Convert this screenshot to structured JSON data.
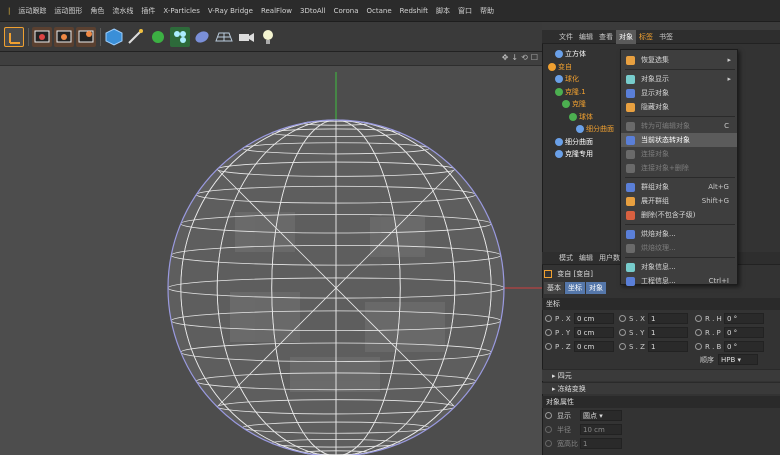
{
  "menubar": {
    "items": [
      "运动跟踪",
      "运动图形",
      "角色",
      "流水线",
      "插件",
      "X-Particles",
      "V-Ray Bridge",
      "RealFlow",
      "3DtoAll",
      "Corona",
      "Octane",
      "Redshift",
      "脚本",
      "窗口",
      "帮助"
    ]
  },
  "object_manager": {
    "tabs": [
      "文件",
      "编辑",
      "查看",
      "对象",
      "标签",
      "书签"
    ],
    "active_tab": "对象",
    "tree": [
      {
        "label": "立方体",
        "indent": 1,
        "color": "#ffffff"
      },
      {
        "label": "变自",
        "indent": 0,
        "color": "#f0a030"
      },
      {
        "label": "球化",
        "indent": 1,
        "color": "#f0a030"
      },
      {
        "label": "克隆.1",
        "indent": 1,
        "color": "#f0a030"
      },
      {
        "label": "克隆",
        "indent": 2,
        "color": "#f0a030"
      },
      {
        "label": "球体",
        "indent": 3,
        "color": "#f0a030"
      },
      {
        "label": "细分曲面",
        "indent": 4,
        "color": "#f0a030"
      },
      {
        "label": "细分曲面",
        "indent": 1,
        "color": "#ffffff"
      },
      {
        "label": "克隆专用",
        "indent": 1,
        "color": "#ffffff"
      }
    ]
  },
  "context_menu": {
    "items": [
      {
        "label": "恢复选集",
        "submenu": true
      },
      {
        "sep": true
      },
      {
        "label": "对象显示",
        "submenu": true
      },
      {
        "label": "显示对象"
      },
      {
        "label": "隐藏对象"
      },
      {
        "sep": true
      },
      {
        "label": "转为可编辑对象",
        "shortcut": "C",
        "disabled": true
      },
      {
        "label": "当前状态转对象",
        "selected": true
      },
      {
        "label": "连接对象",
        "disabled": true
      },
      {
        "label": "连接对象+删除",
        "disabled": true
      },
      {
        "sep": true
      },
      {
        "label": "群组对象",
        "shortcut": "Alt+G"
      },
      {
        "label": "展开群组",
        "shortcut": "Shift+G"
      },
      {
        "label": "删除(不包含子级)"
      },
      {
        "sep": true
      },
      {
        "label": "烘焙对象..."
      },
      {
        "label": "烘焙纹理...",
        "disabled": true
      },
      {
        "sep": true
      },
      {
        "label": "对象信息..."
      },
      {
        "label": "工程信息...",
        "shortcut": "Ctrl+I"
      }
    ]
  },
  "attribute_manager": {
    "tabs": [
      "模式",
      "编辑",
      "用户数"
    ],
    "title": "变自 [变自]",
    "subtabs": [
      "基本",
      "坐标",
      "对象"
    ],
    "active_subtab": "坐标",
    "section_coord": "坐标",
    "rows": [
      {
        "p_label": "P . X",
        "p_val": "0 cm",
        "s_label": "S . X",
        "s_val": "1",
        "r_label": "R . H",
        "r_val": "0 °"
      },
      {
        "p_label": "P . Y",
        "p_val": "0 cm",
        "s_label": "S . Y",
        "s_val": "1",
        "r_label": "R . P",
        "r_val": "0 °"
      },
      {
        "p_label": "P . Z",
        "p_val": "0 cm",
        "s_label": "S . Z",
        "s_val": "1",
        "r_label": "R . B",
        "r_val": "0 °"
      }
    ],
    "order_label": "顺序",
    "order_value": "HPB",
    "collapse_1": "四元",
    "collapse_2": "冻结变换",
    "section_object": "对象属性",
    "display_label": "显示",
    "display_value": "圆点",
    "radius_label": "半径",
    "radius_value": "10 cm",
    "aspect_label": "宽高比",
    "aspect_value": "1"
  },
  "colors": {
    "accent_orange": "#f0a030",
    "grid_wire": "#e8e8e8",
    "axis_green": "#3fbf3f",
    "axis_red": "#d04040"
  }
}
